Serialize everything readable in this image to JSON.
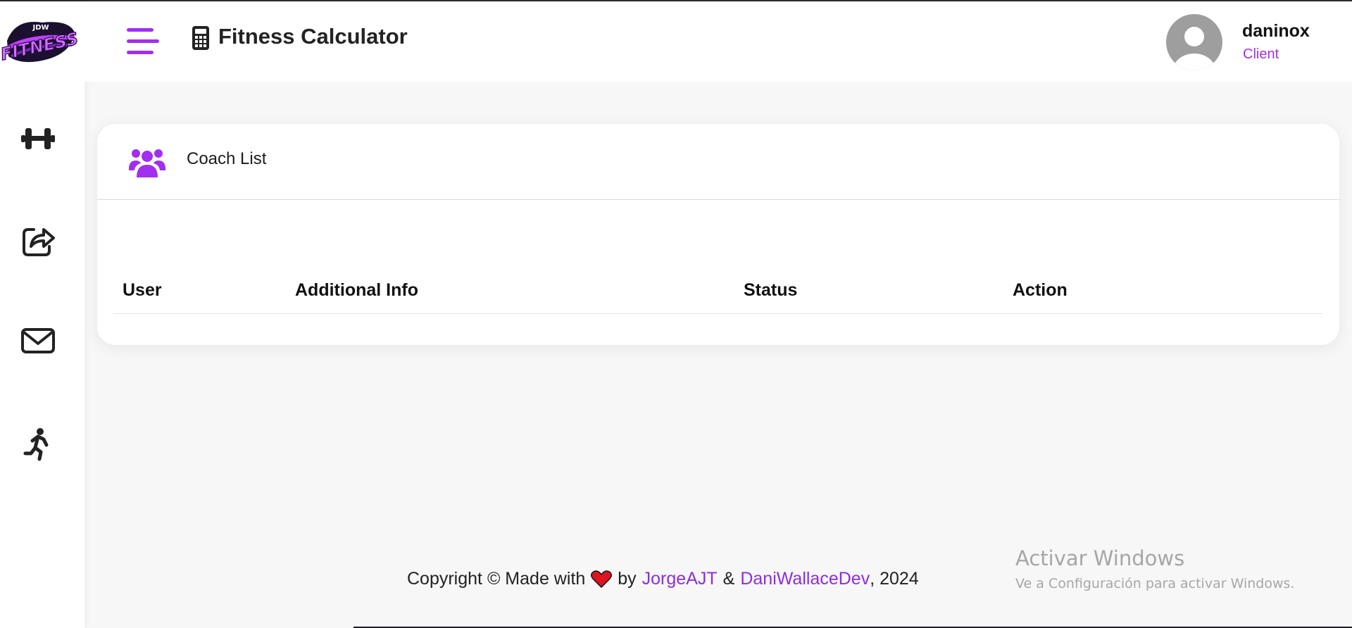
{
  "app": {
    "title": "Fitness Calculator",
    "logo_text_top": "JDW",
    "logo_text_main": "FITNESS"
  },
  "colors": {
    "accent": "#a22ef0",
    "link": "#8e2de0",
    "heart": "#e0141e",
    "text": "#232323",
    "background": "#f7f7f8"
  },
  "sidebar": {
    "items": [
      {
        "icon": "dumbbell-icon"
      },
      {
        "icon": "share-icon"
      },
      {
        "icon": "mail-icon"
      },
      {
        "icon": "running-person-icon"
      }
    ]
  },
  "user": {
    "name": "daninox",
    "role": "Client"
  },
  "card": {
    "title": "Coach List",
    "icon": "users-icon",
    "columns": [
      "User",
      "Additional Info",
      "Status",
      "Action"
    ]
  },
  "footer": {
    "prefix": "Copyright © Made with",
    "by": "by",
    "author1": "JorgeAJT",
    "amp": "&",
    "author2": "DaniWallaceDev",
    "year_suffix": ", 2024"
  },
  "watermark": {
    "title": "Activar Windows",
    "subtitle": "Ve a Configuración para activar Windows."
  }
}
